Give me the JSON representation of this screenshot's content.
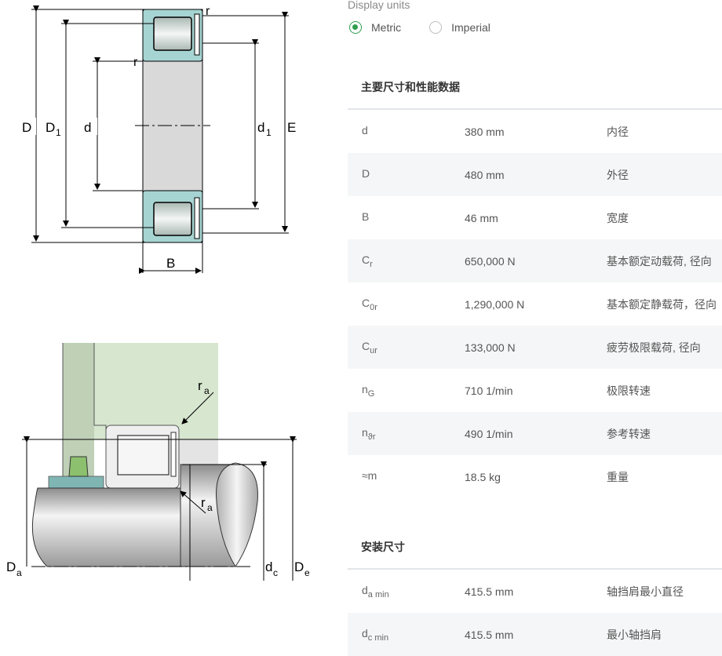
{
  "display_units": {
    "label": "Display units",
    "options": [
      {
        "label": "Metric",
        "selected": true
      },
      {
        "label": "Imperial",
        "selected": false
      }
    ]
  },
  "diagram_labels": {
    "top": {
      "D": "D",
      "D1": "D",
      "D1_sub": "1",
      "d": "d",
      "d1": "d",
      "d1_sub": "1",
      "E": "E",
      "B": "B",
      "r": "r"
    },
    "bottom": {
      "ra": "r",
      "ra_sub": "a",
      "Da": "D",
      "Da_sub": "a",
      "dc": "d",
      "dc_sub": "c",
      "De": "D",
      "De_sub": "e"
    }
  },
  "section_dimensions": {
    "title": "主要尺寸和性能数据",
    "rows": [
      {
        "symbol": "d",
        "sub": "",
        "value": "380 mm",
        "desc": "内径"
      },
      {
        "symbol": "D",
        "sub": "",
        "value": "480 mm",
        "desc": "外径"
      },
      {
        "symbol": "B",
        "sub": "",
        "value": "46 mm",
        "desc": "宽度"
      },
      {
        "symbol": "C",
        "sub": "r",
        "value": "650,000 N",
        "desc": "基本额定动载荷, 径向"
      },
      {
        "symbol": "C",
        "sub": "0r",
        "value": "1,290,000 N",
        "desc": "基本额定静载荷，径向"
      },
      {
        "symbol": "C",
        "sub": "ur",
        "value": "133,000 N",
        "desc": "疲劳极限载荷, 径向"
      },
      {
        "symbol": "n",
        "sub": "G",
        "value": "710 1/min",
        "desc": "极限转速"
      },
      {
        "symbol": "n",
        "sub": "ϑr",
        "value": "490 1/min",
        "desc": "参考转速"
      },
      {
        "symbol": "≈m",
        "sub": "",
        "value": "18.5 kg",
        "desc": "重量"
      }
    ]
  },
  "section_mounting": {
    "title": "安装尺寸",
    "rows": [
      {
        "symbol": "d",
        "sub": "a min",
        "value": "415.5 mm",
        "desc": "轴挡肩最小直径"
      },
      {
        "symbol": "d",
        "sub": "c min",
        "value": "415.5 mm",
        "desc": "最小轴挡肩"
      }
    ]
  }
}
